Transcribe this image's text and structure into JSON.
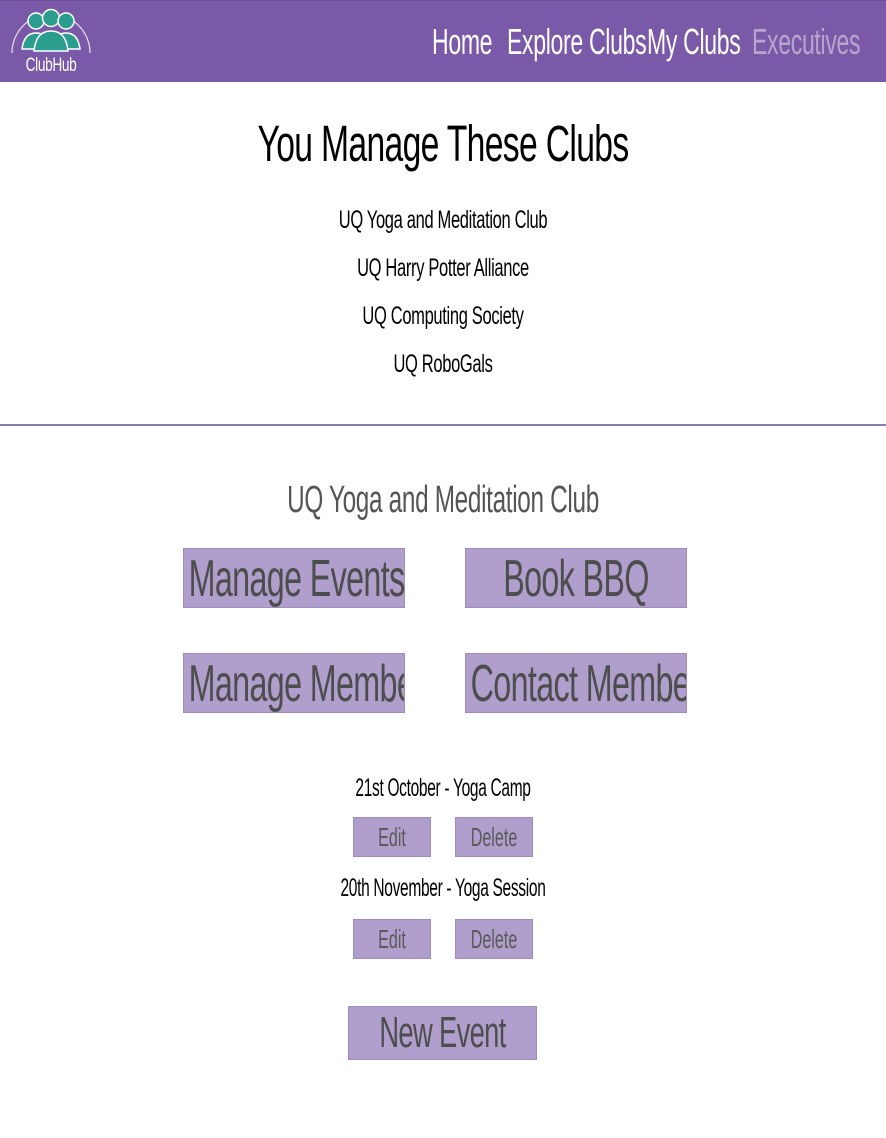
{
  "nav": {
    "logo_text": "ClubHub",
    "links": [
      {
        "label": "Home",
        "active": false
      },
      {
        "label": "Explore Clubs",
        "active": false
      },
      {
        "label": "My Clubs",
        "active": false
      },
      {
        "label": "Executives",
        "active": true
      }
    ]
  },
  "managed": {
    "heading": "You Manage These Clubs",
    "clubs": [
      "UQ Yoga and Meditation Club",
      "UQ Harry Potter Alliance",
      "UQ Computing Society",
      "UQ RoboGals"
    ]
  },
  "selected_club": {
    "name": "UQ Yoga and Meditation Club",
    "actions": {
      "manage_events": "Manage Events",
      "book_bbq": "Book BBQ",
      "manage_members": "Manage Members",
      "contact_members": "Contact Members"
    },
    "events": [
      {
        "title": "21st October - Yoga Camp",
        "edit_label": "Edit",
        "delete_label": "Delete"
      },
      {
        "title": "20th November - Yoga Session",
        "edit_label": "Edit",
        "delete_label": "Delete"
      }
    ],
    "new_event_label": "New Event"
  },
  "icons": {
    "logo": "people-group-logo-icon"
  },
  "colors": {
    "nav_bg": "#7a59a8",
    "nav_active": "#b6a5cc",
    "button_bg": "#b09ecd",
    "logo_people": "#2a9d8f",
    "divider": "#8e7bb4"
  }
}
